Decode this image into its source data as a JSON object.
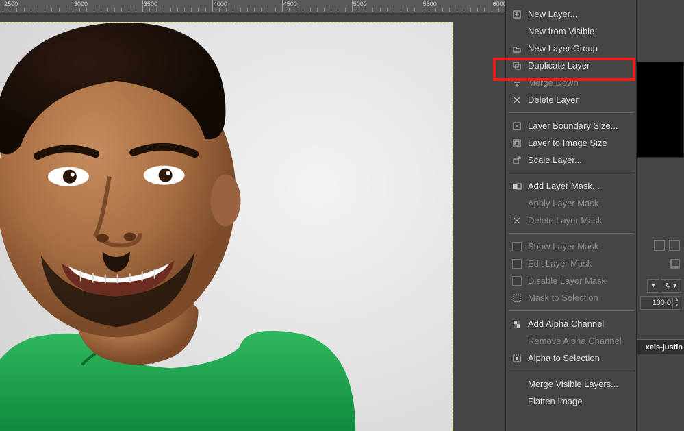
{
  "ruler": {
    "marks": [
      2500,
      3000,
      3500,
      4000,
      4500,
      5000,
      5500,
      6000
    ]
  },
  "menu": {
    "new_layer": "New Layer...",
    "new_from_visible": "New from Visible",
    "new_layer_group": "New Layer Group",
    "duplicate_layer": "Duplicate Layer",
    "merge_down": "Merge Down",
    "delete_layer": "Delete Layer",
    "layer_boundary_size": "Layer Boundary Size...",
    "layer_to_image_size": "Layer to Image Size",
    "scale_layer": "Scale Layer...",
    "add_layer_mask": "Add Layer Mask...",
    "apply_layer_mask": "Apply Layer Mask",
    "delete_layer_mask": "Delete Layer Mask",
    "show_layer_mask": "Show Layer Mask",
    "edit_layer_mask": "Edit Layer Mask",
    "disable_layer_mask": "Disable Layer Mask",
    "mask_to_selection": "Mask to Selection",
    "add_alpha_channel": "Add Alpha Channel",
    "remove_alpha_channel": "Remove Alpha Channel",
    "alpha_to_selection": "Alpha to Selection",
    "merge_visible_layers": "Merge Visible Layers...",
    "flatten_image": "Flatten Image"
  },
  "dock": {
    "opacity_value": "100.0",
    "layer_file_fragment": "xels-justin"
  },
  "highlighted_item_key": "duplicate_layer"
}
